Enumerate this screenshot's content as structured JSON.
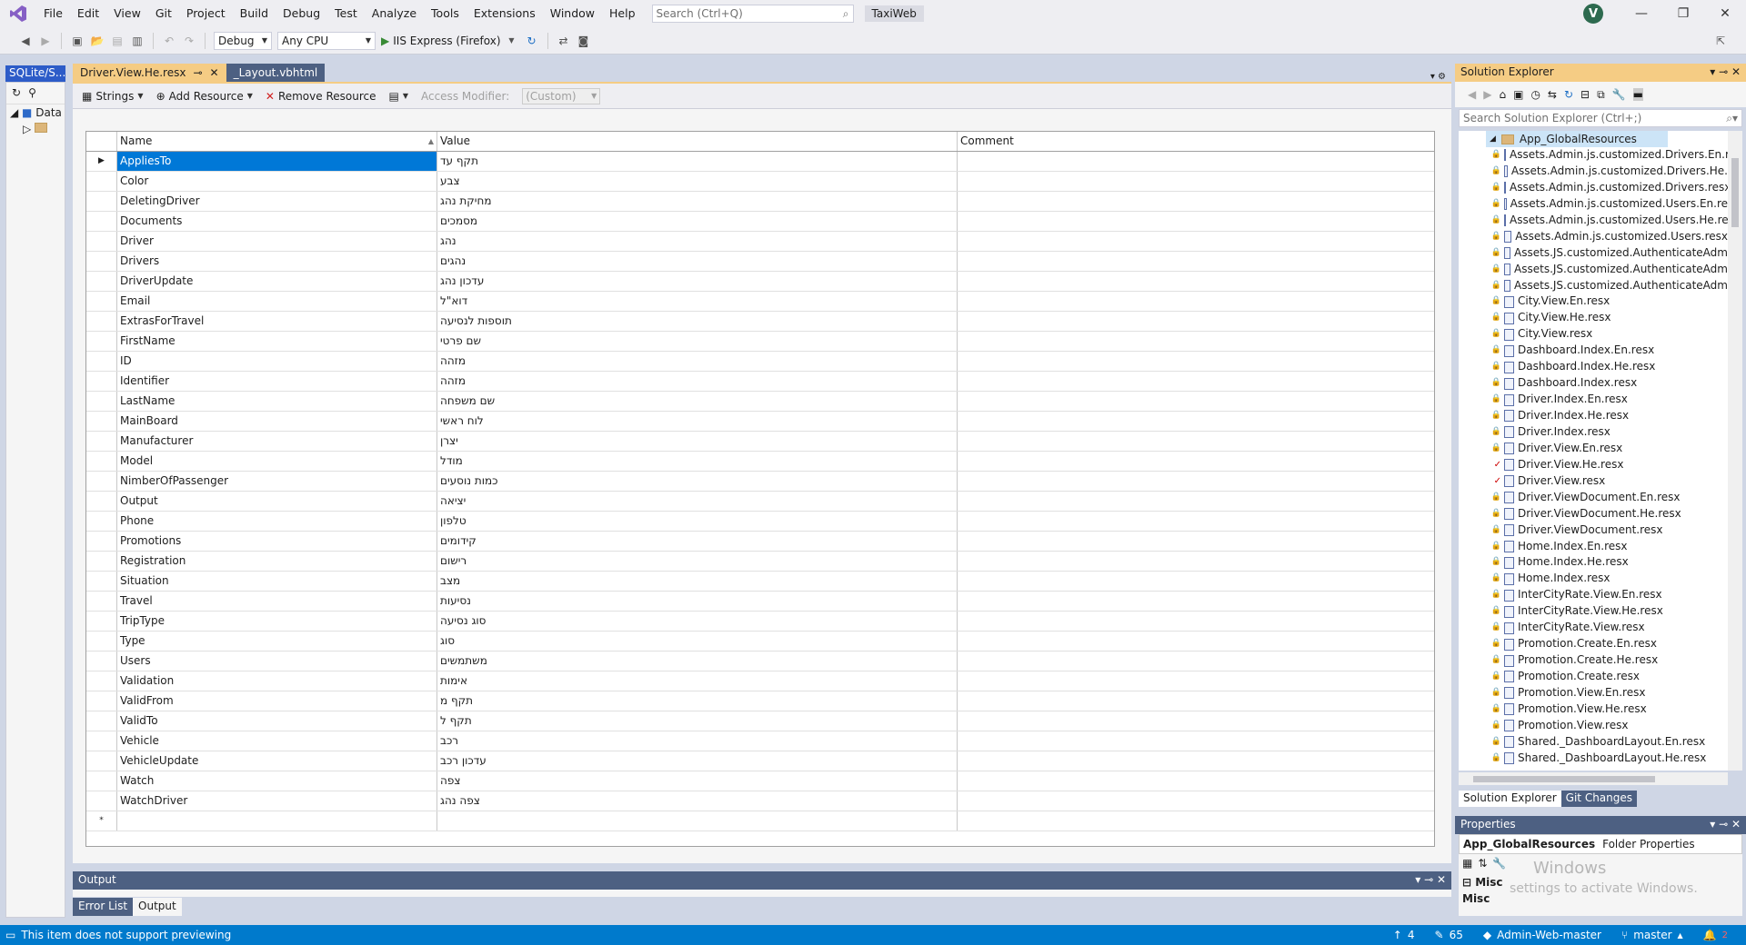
{
  "menu": [
    "File",
    "Edit",
    "View",
    "Git",
    "Project",
    "Build",
    "Debug",
    "Test",
    "Analyze",
    "Tools",
    "Extensions",
    "Window",
    "Help"
  ],
  "search": {
    "placeholder": "Search (Ctrl+Q)"
  },
  "solution_name": "TaxiWeb",
  "user_initial": "V",
  "toolbar": {
    "config": "Debug",
    "platform": "Any CPU",
    "run_target": "IIS Express (Firefox)"
  },
  "left_panel": {
    "tab": "SQLite/S...",
    "tree_item": "Data"
  },
  "doc_tabs": [
    {
      "label": "Driver.View.He.resx",
      "active": true
    },
    {
      "label": "_Layout.vbhtml",
      "active": false
    }
  ],
  "resource_toolbar": {
    "strings": "Strings",
    "add_resource": "Add Resource",
    "remove_resource": "Remove Resource",
    "access_modifier_label": "Access Modifier:",
    "access_modifier_value": "(Custom)"
  },
  "grid": {
    "columns": [
      "Name",
      "Value",
      "Comment"
    ],
    "rows": [
      [
        "AppliesTo",
        "תקף עד",
        ""
      ],
      [
        "Color",
        "צבע",
        ""
      ],
      [
        "DeletingDriver",
        "מחיקת נהג",
        ""
      ],
      [
        "Documents",
        "מסמכים",
        ""
      ],
      [
        "Driver",
        "נהג",
        ""
      ],
      [
        "Drivers",
        "נהגים",
        ""
      ],
      [
        "DriverUpdate",
        "עדכון נהג",
        ""
      ],
      [
        "Email",
        "דוא\"ל",
        ""
      ],
      [
        "ExtrasForTravel",
        "תוספות לנסיעה",
        ""
      ],
      [
        "FirstName",
        "שם פרטי",
        ""
      ],
      [
        "ID",
        "מזהה",
        ""
      ],
      [
        "Identifier",
        "מזהה",
        ""
      ],
      [
        "LastName",
        "שם משפחה",
        ""
      ],
      [
        "MainBoard",
        "לוח ראשי",
        ""
      ],
      [
        "Manufacturer",
        "יצרן",
        ""
      ],
      [
        "Model",
        "מודל",
        ""
      ],
      [
        "NimberOfPassenger",
        "כמות נוסעים",
        ""
      ],
      [
        "Output",
        "יציאה",
        ""
      ],
      [
        "Phone",
        "טלפון",
        ""
      ],
      [
        "Promotions",
        "קידומים",
        ""
      ],
      [
        "Registration",
        "רישום",
        ""
      ],
      [
        "Situation",
        "מצב",
        ""
      ],
      [
        "Travel",
        "נסיעות",
        ""
      ],
      [
        "TripType",
        "סוג נסיעה",
        ""
      ],
      [
        "Type",
        "סוג",
        ""
      ],
      [
        "Users",
        "משתמשים",
        ""
      ],
      [
        "Validation",
        "אימות",
        ""
      ],
      [
        "ValidFrom",
        "תקף מ",
        ""
      ],
      [
        "ValidTo",
        "תקף ל",
        ""
      ],
      [
        "Vehicle",
        "רכב",
        ""
      ],
      [
        "VehicleUpdate",
        "עדכון רכב",
        ""
      ],
      [
        "Watch",
        "צפה",
        ""
      ],
      [
        "WatchDriver",
        "צפה נהג",
        ""
      ]
    ],
    "new_row_marker": "*",
    "selected_marker": "▶"
  },
  "output": {
    "title": "Output"
  },
  "bottom_tabs": [
    "Error List",
    "Output"
  ],
  "solution_explorer": {
    "title": "Solution Explorer",
    "search_placeholder": "Search Solution Explorer (Ctrl+;)",
    "root": "App_GlobalResources",
    "items": [
      {
        "label": "Assets.Admin.js.customized.Drivers.En.r",
        "check": false
      },
      {
        "label": "Assets.Admin.js.customized.Drivers.He.",
        "check": false
      },
      {
        "label": "Assets.Admin.js.customized.Drivers.resx",
        "check": false
      },
      {
        "label": "Assets.Admin.js.customized.Users.En.re",
        "check": false
      },
      {
        "label": "Assets.Admin.js.customized.Users.He.re",
        "check": false
      },
      {
        "label": "Assets.Admin.js.customized.Users.resx",
        "check": false
      },
      {
        "label": "Assets.JS.customized.AuthenticateAdm",
        "check": false
      },
      {
        "label": "Assets.JS.customized.AuthenticateAdm",
        "check": false
      },
      {
        "label": "Assets.JS.customized.AuthenticateAdm",
        "check": false
      },
      {
        "label": "City.View.En.resx",
        "check": false
      },
      {
        "label": "City.View.He.resx",
        "check": false
      },
      {
        "label": "City.View.resx",
        "check": false
      },
      {
        "label": "Dashboard.Index.En.resx",
        "check": false
      },
      {
        "label": "Dashboard.Index.He.resx",
        "check": false
      },
      {
        "label": "Dashboard.Index.resx",
        "check": false
      },
      {
        "label": "Driver.Index.En.resx",
        "check": false
      },
      {
        "label": "Driver.Index.He.resx",
        "check": false
      },
      {
        "label": "Driver.Index.resx",
        "check": false
      },
      {
        "label": "Driver.View.En.resx",
        "check": false
      },
      {
        "label": "Driver.View.He.resx",
        "check": true
      },
      {
        "label": "Driver.View.resx",
        "check": true
      },
      {
        "label": "Driver.ViewDocument.En.resx",
        "check": false
      },
      {
        "label": "Driver.ViewDocument.He.resx",
        "check": false
      },
      {
        "label": "Driver.ViewDocument.resx",
        "check": false
      },
      {
        "label": "Home.Index.En.resx",
        "check": false
      },
      {
        "label": "Home.Index.He.resx",
        "check": false
      },
      {
        "label": "Home.Index.resx",
        "check": false
      },
      {
        "label": "InterCityRate.View.En.resx",
        "check": false
      },
      {
        "label": "InterCityRate.View.He.resx",
        "check": false
      },
      {
        "label": "InterCityRate.View.resx",
        "check": false
      },
      {
        "label": "Promotion.Create.En.resx",
        "check": false
      },
      {
        "label": "Promotion.Create.He.resx",
        "check": false
      },
      {
        "label": "Promotion.Create.resx",
        "check": false
      },
      {
        "label": "Promotion.View.En.resx",
        "check": false
      },
      {
        "label": "Promotion.View.He.resx",
        "check": false
      },
      {
        "label": "Promotion.View.resx",
        "check": false
      },
      {
        "label": "Shared._DashboardLayout.En.resx",
        "check": false
      },
      {
        "label": "Shared._DashboardLayout.He.resx",
        "check": false
      }
    ],
    "tabs": [
      "Solution Explorer",
      "Git Changes"
    ]
  },
  "properties": {
    "title": "Properties",
    "object_name": "App_GlobalResources",
    "object_type": "Folder Properties",
    "category": "Misc",
    "category2": "Misc"
  },
  "watermark": {
    "line1": "Windows",
    "line2": "settings to activate Windows."
  },
  "statusbar": {
    "message": "This item does not support previewing",
    "up_count": "4",
    "edit_count": "65",
    "repo": "Admin-Web-master",
    "branch": "master",
    "notifications": "2"
  },
  "colors": {
    "accent": "#007acc",
    "selection": "#0078d7",
    "active_tab": "#f5cc84",
    "inactive_tab": "#4d6082"
  }
}
